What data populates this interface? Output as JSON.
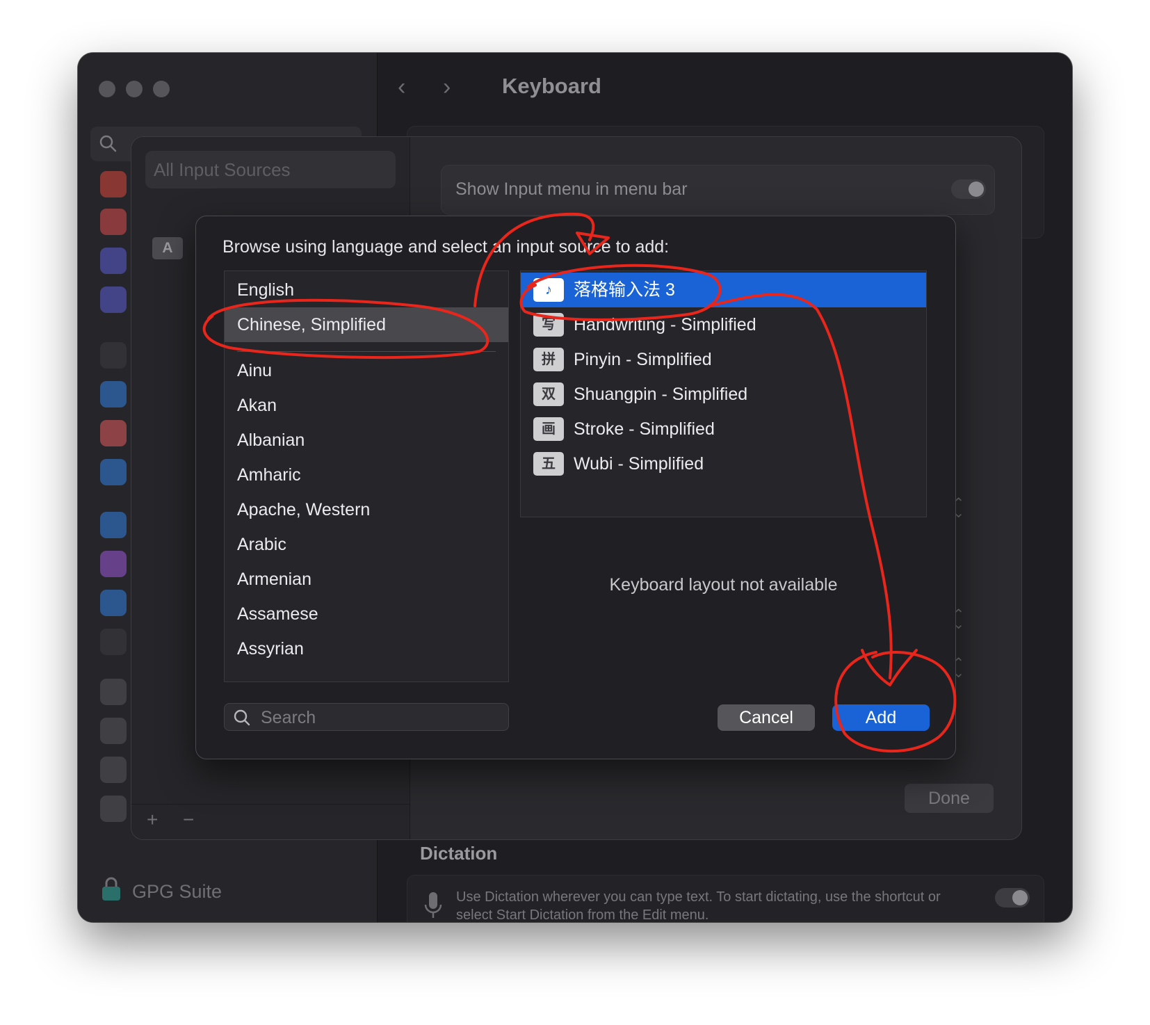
{
  "window": {
    "title": "Keyboard",
    "nav_back": "‹",
    "nav_forward": "›"
  },
  "sidebar": {
    "search_icon": "search-icon",
    "bottom_item": "GPG Suite",
    "icon_colors": [
      "#d8463a",
      "#d84a4a",
      "#5b5bd6",
      "#5b5bd6",
      "#3a3a3f",
      "#2f7fe0",
      "#e25b5b",
      "#2f7fe0",
      "#2f7fe0",
      "#9a56d6",
      "#2f7fe0",
      "#3a3a3f",
      "#55555a",
      "#55555a",
      "#55555a",
      "#55555a"
    ]
  },
  "sheet": {
    "all_input_sources": "All Input Sources",
    "source_badge": "A",
    "add_symbol": "+",
    "remove_symbol": "−",
    "show_input_menu_label": "Show Input menu in menu bar",
    "done_label": "Done"
  },
  "dictation": {
    "title": "Dictation",
    "text": "Use Dictation wherever you can type text. To start dictating, use the shortcut or select Start Dictation from the Edit menu."
  },
  "dialog": {
    "prompt": "Browse using language and select an input source to add:",
    "languages": {
      "pinned": [
        "English",
        "Chinese, Simplified"
      ],
      "others": [
        "Ainu",
        "Akan",
        "Albanian",
        "Amharic",
        "Apache, Western",
        "Arabic",
        "Armenian",
        "Assamese",
        "Assyrian"
      ],
      "selected": "Chinese, Simplified"
    },
    "sources": [
      {
        "label": "落格输入法 3",
        "glyph": "♪",
        "icon": "luoge-input-icon"
      },
      {
        "label": "Handwriting - Simplified",
        "glyph": "写",
        "icon": "handwriting-icon"
      },
      {
        "label": "Pinyin - Simplified",
        "glyph": "拼",
        "icon": "pinyin-icon"
      },
      {
        "label": "Shuangpin - Simplified",
        "glyph": "双",
        "icon": "shuangpin-icon"
      },
      {
        "label": "Stroke - Simplified",
        "glyph": "画",
        "icon": "stroke-icon"
      },
      {
        "label": "Wubi - Simplified",
        "glyph": "五",
        "icon": "wubi-icon"
      }
    ],
    "selected_source": "落格输入法 3",
    "keyboard_layout_message": "Keyboard layout not available",
    "search_placeholder": "Search",
    "cancel_label": "Cancel",
    "add_label": "Add",
    "accent_color": "#1a63d6"
  },
  "annotations": {
    "color": "#e8261c"
  }
}
